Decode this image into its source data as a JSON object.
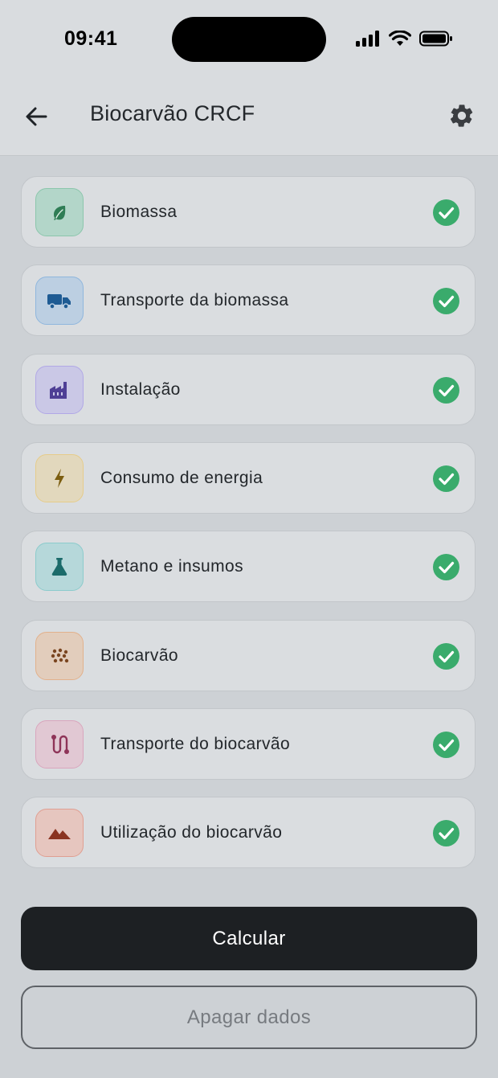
{
  "status_bar": {
    "time": "09:41"
  },
  "app_bar": {
    "title": "Biocarvão CRCF"
  },
  "items": [
    {
      "label": "Biomassa",
      "icon": "leaf-icon",
      "bg": "#b3d6c9",
      "border": "#8cc6ac",
      "fg": "#2f7d55",
      "completed": true
    },
    {
      "label": "Transporte da biomassa",
      "icon": "truck-icon",
      "bg": "#bccfe2",
      "border": "#8fb6dd",
      "fg": "#1e5b93",
      "completed": true
    },
    {
      "label": "Instalação",
      "icon": "factory-icon",
      "bg": "#cac8e6",
      "border": "#b1a8e6",
      "fg": "#4e3f95",
      "completed": true
    },
    {
      "label": "Consumo de energia",
      "icon": "bolt-icon",
      "bg": "#e2d8bd",
      "border": "#e6cc8a",
      "fg": "#7c5e10",
      "completed": true
    },
    {
      "label": "Metano e insumos",
      "icon": "flask-icon",
      "bg": "#b6d8da",
      "border": "#8ccbcc",
      "fg": "#1b6b6a",
      "completed": true
    },
    {
      "label": "Biocarvão",
      "icon": "pellets-icon",
      "bg": "#e2cdbc",
      "border": "#e2b18c",
      "fg": "#7a4520",
      "completed": true
    },
    {
      "label": "Transporte do biocarvão",
      "icon": "route-icon",
      "bg": "#e1c8d3",
      "border": "#d9a6bd",
      "fg": "#8e3458",
      "completed": true
    },
    {
      "label": "Utilização do biocarvão",
      "icon": "mountain-icon",
      "bg": "#e6c6bf",
      "border": "#e09f92",
      "fg": "#8a3320",
      "completed": true
    }
  ],
  "colors": {
    "check": "#3aab6c",
    "primary_button": "#1d2023"
  },
  "actions": {
    "calculate_label": "Calcular",
    "clear_label": "Apagar dados"
  }
}
